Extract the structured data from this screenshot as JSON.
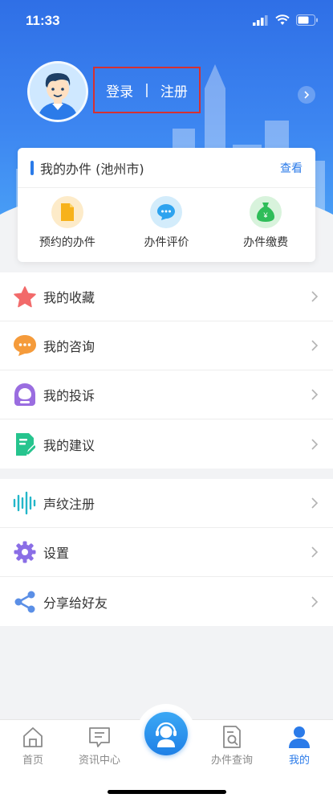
{
  "status_bar": {
    "time": "11:33"
  },
  "profile": {
    "login_label": "登录",
    "separator": "|",
    "register_label": "注册"
  },
  "card": {
    "title": "我的办件 (池州市)",
    "link": "查看",
    "items": [
      {
        "label": "预约的办件",
        "icon": "document-icon"
      },
      {
        "label": "办件评价",
        "icon": "chat-bubble-icon"
      },
      {
        "label": "办件缴费",
        "icon": "money-bag-icon"
      }
    ]
  },
  "menu_group_1": [
    {
      "label": "我的收藏",
      "icon": "star-icon"
    },
    {
      "label": "我的咨询",
      "icon": "consult-icon"
    },
    {
      "label": "我的投诉",
      "icon": "complaint-icon"
    },
    {
      "label": "我的建议",
      "icon": "suggestion-icon"
    }
  ],
  "menu_group_2": [
    {
      "label": "声纹注册",
      "icon": "voiceprint-icon"
    },
    {
      "label": "设置",
      "icon": "gear-icon"
    },
    {
      "label": "分享给好友",
      "icon": "share-icon"
    }
  ],
  "bottom_nav": [
    {
      "label": "首页",
      "icon": "home-icon"
    },
    {
      "label": "资讯中心",
      "icon": "news-icon"
    },
    {
      "label": "",
      "icon": "customer-service-icon"
    },
    {
      "label": "办件查询",
      "icon": "search-document-icon"
    },
    {
      "label": "我的",
      "icon": "user-icon",
      "active": true
    }
  ],
  "colors": {
    "primary": "#2b7be9",
    "highlight_border": "#d53131"
  }
}
